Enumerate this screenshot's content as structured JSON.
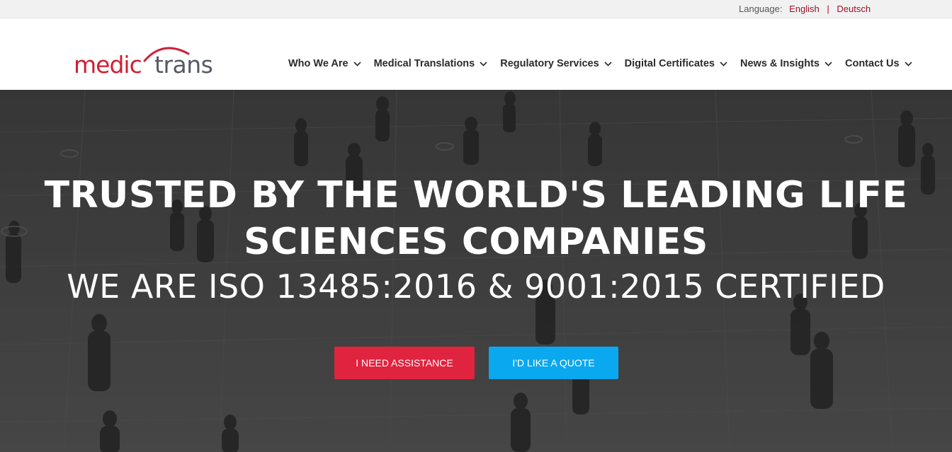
{
  "language_bar": {
    "label": "Language:",
    "options": [
      "English",
      "Deutsch"
    ],
    "separator": "|",
    "link_color": "#a0102a"
  },
  "logo": {
    "part1": "medic",
    "part2": "trans",
    "brand_red": "#cf1f33",
    "brand_gray": "#555a60"
  },
  "nav": {
    "items": [
      {
        "label": "Who We Are",
        "icon": "chevron-down-icon"
      },
      {
        "label": "Medical Translations",
        "icon": "chevron-down-icon"
      },
      {
        "label": "Regulatory Services",
        "icon": "chevron-down-icon"
      },
      {
        "label": "Digital Certificates",
        "icon": "chevron-down-icon"
      },
      {
        "label": "News & Insights",
        "icon": "chevron-down-icon"
      },
      {
        "label": "Contact Us",
        "icon": "chevron-down-icon"
      }
    ]
  },
  "hero": {
    "headline_line1": "TRUSTED BY THE WORLD'S LEADING LIFE",
    "headline_line2": "SCIENCES COMPANIES",
    "subheadline": "WE ARE ISO 13485:2016 & 9001:2015 CERTIFIED",
    "buttons": {
      "assistance": "I NEED ASSISTANCE",
      "quote": "I'D LIKE A QUOTE"
    },
    "colors": {
      "assistance": "#e0233f",
      "quote": "#0aa8ef"
    }
  }
}
